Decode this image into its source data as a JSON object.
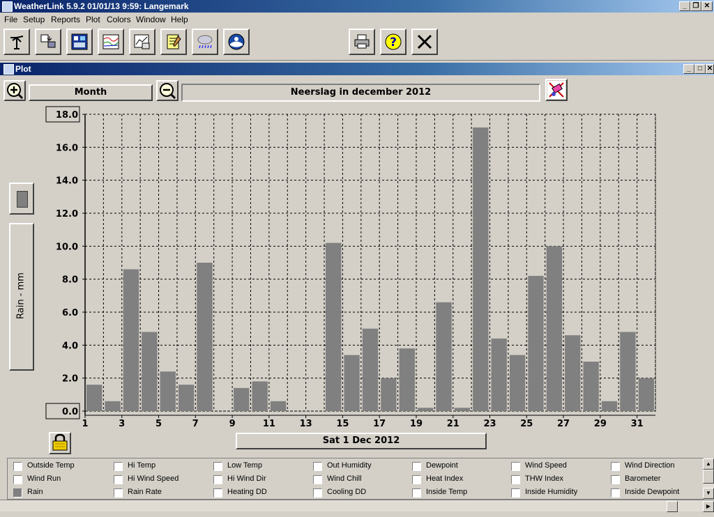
{
  "app": {
    "title": "WeatherLink 5.9.2  01/01/13  9:59: Langemark"
  },
  "menu": [
    "File",
    "Setup",
    "Reports",
    "Plot",
    "Colors",
    "Window",
    "Help"
  ],
  "toolbar_icons": [
    "station-icon",
    "download-icon",
    "bulletin-icon",
    "strip-chart-icon",
    "plot-icon",
    "notepad-icon",
    "weather-rain-icon",
    "noaa-icon",
    "printer-icon",
    "help-icon",
    "close-icon"
  ],
  "plot_window": {
    "title": "Plot",
    "period_label": "Month",
    "plot_title": "Neerslag in december 2012",
    "date_label": "Sat 1 Dec 2012",
    "y_axis_button": "Rain - mm"
  },
  "chart_data": {
    "type": "bar",
    "title": "Neerslag in december 2012",
    "ylabel": "Rain - mm",
    "xlabel": "",
    "ylim": [
      0,
      18
    ],
    "yticks": [
      "0.0",
      "2.0",
      "4.0",
      "6.0",
      "8.0",
      "10.0",
      "12.0",
      "14.0",
      "16.0",
      "18.0"
    ],
    "xticks": [
      "1",
      "3",
      "5",
      "7",
      "9",
      "11",
      "13",
      "15",
      "17",
      "19",
      "21",
      "23",
      "25",
      "27",
      "29",
      "31"
    ],
    "categories": [
      1,
      2,
      3,
      4,
      5,
      6,
      7,
      8,
      9,
      10,
      11,
      12,
      13,
      14,
      15,
      16,
      17,
      18,
      19,
      20,
      21,
      22,
      23,
      24,
      25,
      26,
      27,
      28,
      29,
      30,
      31
    ],
    "values": [
      1.6,
      0.6,
      8.6,
      4.8,
      2.4,
      1.6,
      9.0,
      0.0,
      1.4,
      1.8,
      0.6,
      0.0,
      0.0,
      10.2,
      3.4,
      5.0,
      2.0,
      3.8,
      0.2,
      6.6,
      0.2,
      17.2,
      4.4,
      3.4,
      8.2,
      10.0,
      4.6,
      3.0,
      0.6,
      4.8,
      2.0
    ],
    "bar_color": "#808080",
    "grid": true
  },
  "legend": [
    {
      "label": "Outside Temp",
      "checked": false
    },
    {
      "label": "Hi Temp",
      "checked": false
    },
    {
      "label": "Low Temp",
      "checked": false
    },
    {
      "label": "Out Humidity",
      "checked": false
    },
    {
      "label": "Dewpoint",
      "checked": false
    },
    {
      "label": "Wind Speed",
      "checked": false
    },
    {
      "label": "Wind Direction",
      "checked": false
    },
    {
      "label": "Wind Run",
      "checked": false
    },
    {
      "label": "Hi Wind Speed",
      "checked": false
    },
    {
      "label": "Hi Wind Dir",
      "checked": false
    },
    {
      "label": "Wind Chill",
      "checked": false
    },
    {
      "label": "Heat Index",
      "checked": false
    },
    {
      "label": "THW Index",
      "checked": false
    },
    {
      "label": "Barometer",
      "checked": false
    },
    {
      "label": "Rain",
      "checked": true
    },
    {
      "label": "Rain Rate",
      "checked": false
    },
    {
      "label": "Heating DD",
      "checked": false
    },
    {
      "label": "Cooling DD",
      "checked": false
    },
    {
      "label": "Inside Temp",
      "checked": false
    },
    {
      "label": "Inside Humidity",
      "checked": false
    },
    {
      "label": "Inside Dewpoint",
      "checked": false
    }
  ]
}
